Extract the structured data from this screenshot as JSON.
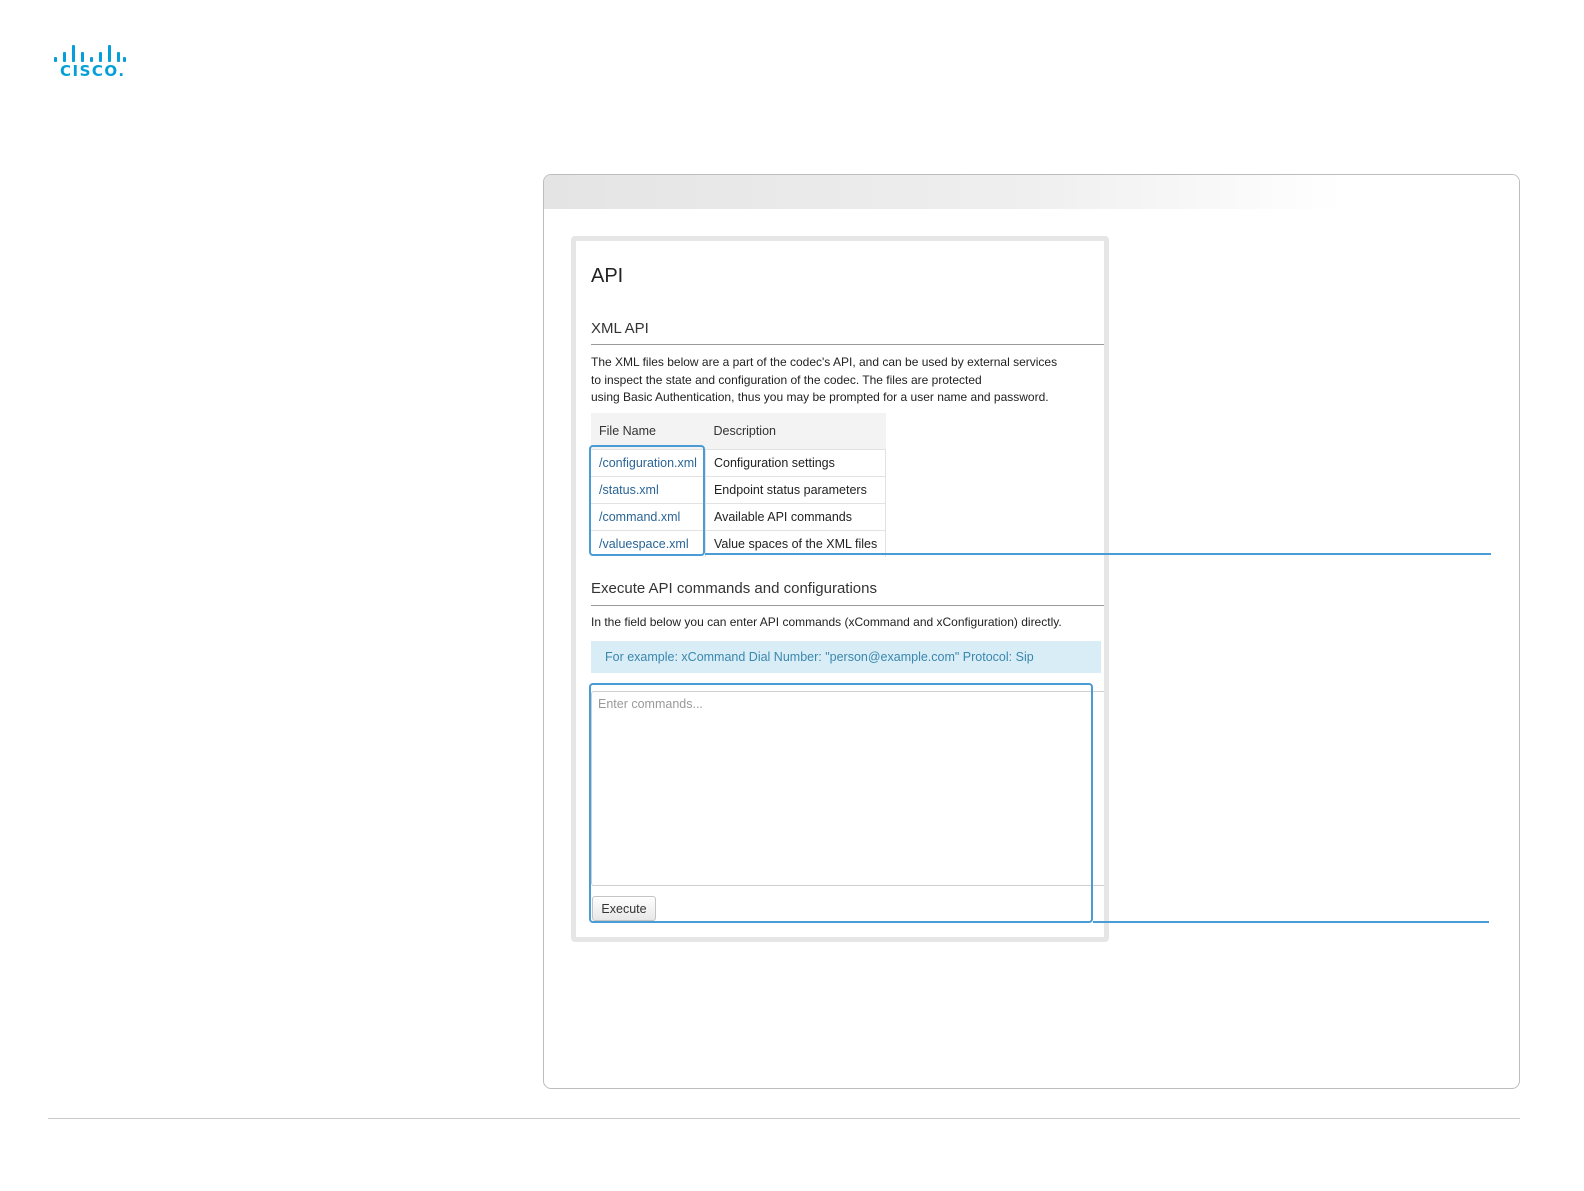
{
  "logo": {
    "word": "CISCO."
  },
  "api_page": {
    "title": "API",
    "xml_api": {
      "heading": "XML API",
      "description": [
        "The XML files below are a part of the codec's API, and can be used by external services",
        "to inspect the state and configuration of the codec. The files are protected",
        "using Basic Authentication, thus you may be prompted for a user name and password."
      ],
      "table": {
        "headers": [
          "File Name",
          "Description"
        ],
        "rows": [
          {
            "file": "/configuration.xml",
            "description": "Configuration settings"
          },
          {
            "file": "/status.xml",
            "description": "Endpoint status parameters"
          },
          {
            "file": "/command.xml",
            "description": "Available API commands"
          },
          {
            "file": "/valuespace.xml",
            "description": "Value spaces of the XML files"
          }
        ]
      }
    },
    "execute": {
      "heading": "Execute API commands and configurations",
      "description": "In the field below you can enter API commands (xCommand and xConfiguration) directly.",
      "example": "For example: xCommand Dial Number: \"person@example.com\" Protocol: Sip",
      "placeholder": "Enter commands...",
      "button_label": "Execute"
    }
  },
  "colors": {
    "brand": "#049fd9",
    "highlight": "#4a9bd6",
    "info_bg": "#d9edf7",
    "info_text": "#3a87ad",
    "link": "#2a6496"
  }
}
